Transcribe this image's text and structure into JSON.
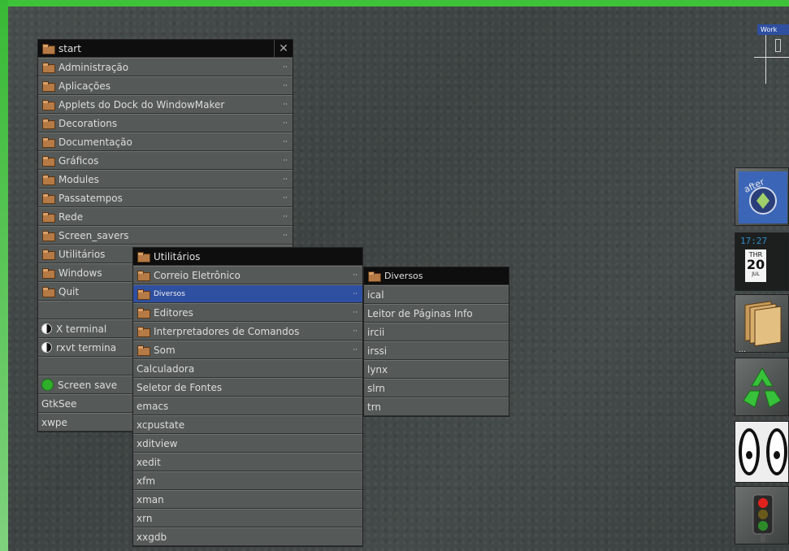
{
  "main_menu": {
    "title": "start",
    "items": [
      {
        "label": "Administração",
        "submenu": true
      },
      {
        "label": "Aplicações",
        "submenu": true
      },
      {
        "label": "Applets do Dock do WindowMaker",
        "submenu": true
      },
      {
        "label": "Decorations",
        "submenu": true
      },
      {
        "label": "Documentação",
        "submenu": true
      },
      {
        "label": "Gráficos",
        "submenu": true
      },
      {
        "label": "Modules",
        "submenu": true
      },
      {
        "label": "Passatempos",
        "submenu": true
      },
      {
        "label": "Rede",
        "submenu": true
      },
      {
        "label": "Screen_savers",
        "submenu": true
      },
      {
        "label": "Utilitários",
        "submenu": true
      },
      {
        "label": "Windows",
        "submenu": true
      },
      {
        "label": "Quit",
        "submenu": true
      }
    ],
    "extra_items": [
      "X terminal",
      "rxvt termina",
      "Screen save",
      "GtkSee",
      "xwpe"
    ]
  },
  "utilitarios_menu": {
    "title": "Utilitários",
    "items": [
      "Correio Eletrônico",
      "Diversos",
      "Editores",
      "Interpretadores de Comandos",
      "Som",
      "Calculadora",
      "Seletor de Fontes",
      "emacs",
      "xcpustate",
      "xditview",
      "xedit",
      "xfm",
      "xman",
      "xrn",
      "xxgdb"
    ]
  },
  "diversos_menu": {
    "title": "Diversos",
    "items": [
      "ical",
      "Leitor de Páginas Info",
      "ircii",
      "irssi",
      "lynx",
      "slrn",
      "trn"
    ]
  },
  "arrow_glyph": "··",
  "dock": {
    "workspace_label": "Work",
    "clock_time": "17:27",
    "calendar": {
      "weekday": "THR",
      "day": "20",
      "month": "JUL"
    }
  }
}
